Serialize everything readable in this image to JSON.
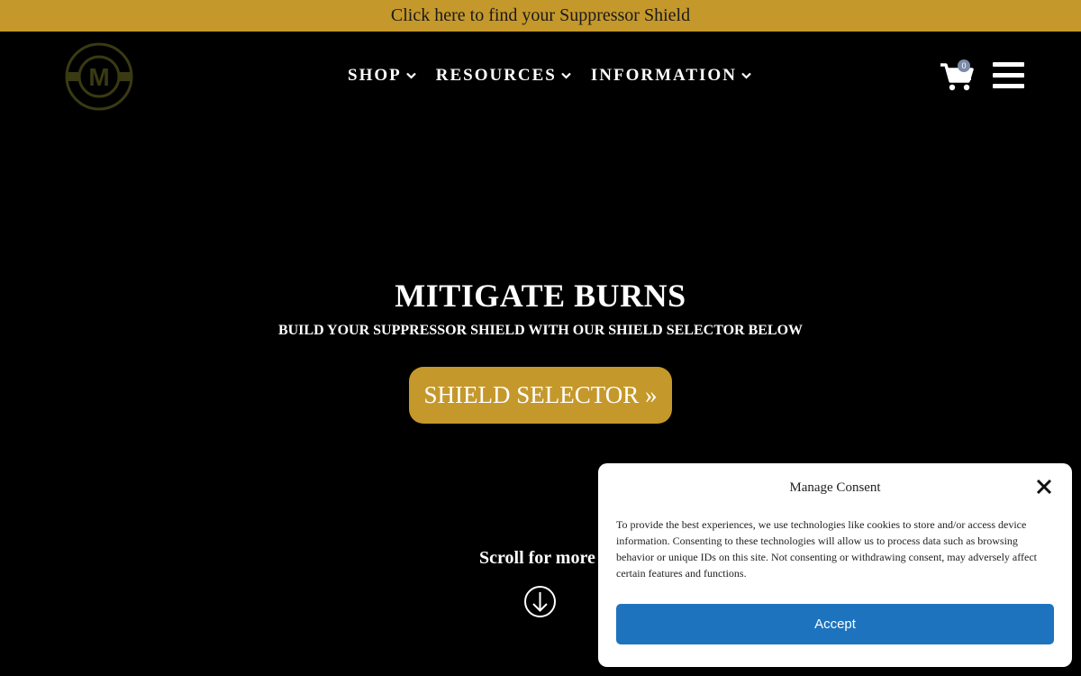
{
  "topbar": {
    "text": "Click here to find your Suppressor Shield"
  },
  "header": {
    "logo_letter": "M",
    "nav": [
      {
        "label": "SHOP"
      },
      {
        "label": "RESOURCES"
      },
      {
        "label": "INFORMATION"
      }
    ],
    "cart_count": "0"
  },
  "hero": {
    "title": "MITIGATE BURNS",
    "subtitle": "BUILD YOUR SUPPRESSOR SHIELD WITH OUR SHIELD SELECTOR BELOW",
    "cta_label": "SHIELD SELECTOR »"
  },
  "scroll": {
    "label": "Scroll for more"
  },
  "consent": {
    "title": "Manage Consent",
    "body": "To provide the best experiences, we use technologies like cookies to store and/or access device information. Consenting to these technologies will allow us to process data such as browsing behavior or unique IDs on this site. Not consenting or withdrawing consent, may adversely affect certain features and functions.",
    "accept_label": "Accept"
  },
  "colors": {
    "brand_gold": "#c5982b",
    "background": "#000000",
    "accept_blue": "#1e73be",
    "logo_olive": "#3a3a12"
  },
  "icons": [
    "logo-icon",
    "chevron-down-icon",
    "cart-icon",
    "hamburger-menu-icon",
    "arrow-down-circle-icon",
    "close-icon"
  ]
}
